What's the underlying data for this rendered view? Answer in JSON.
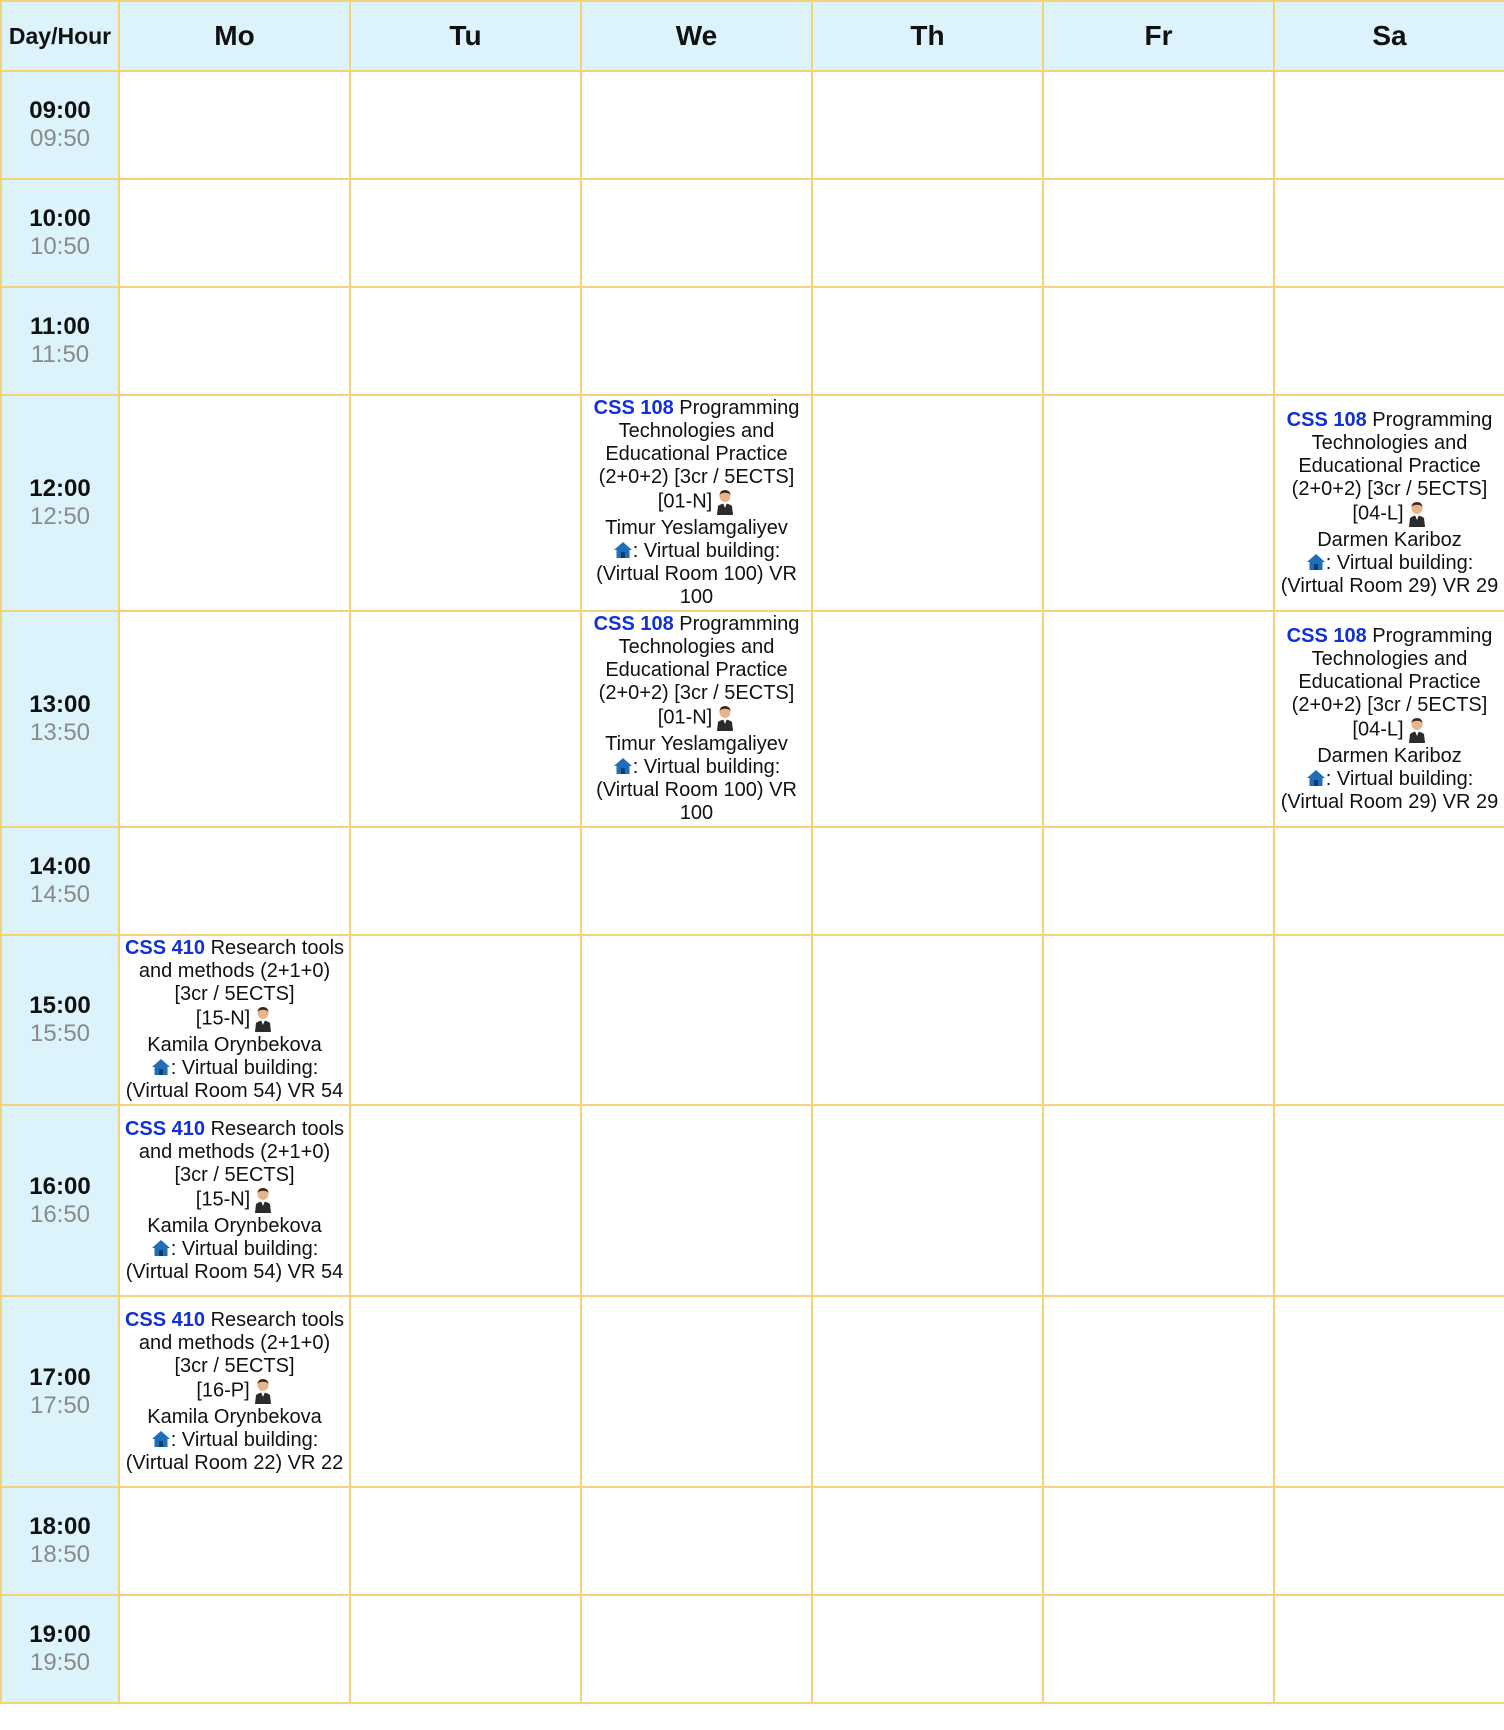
{
  "header": {
    "corner_label": "Day/Hour",
    "days": [
      "Mo",
      "Tu",
      "We",
      "Th",
      "Fr",
      "Sa"
    ]
  },
  "icons": {
    "teacher": "person-icon",
    "location": "home-icon"
  },
  "colors": {
    "header_bg": "#dcf3fb",
    "border": "#f6d27a",
    "course_code": "#1030d8",
    "end_time": "#8a8a8a"
  },
  "rows": [
    {
      "start": "09:00",
      "end": "09:50",
      "cells": [
        null,
        null,
        null,
        null,
        null,
        null
      ]
    },
    {
      "start": "10:00",
      "end": "10:50",
      "cells": [
        null,
        null,
        null,
        null,
        null,
        null
      ]
    },
    {
      "start": "11:00",
      "end": "11:50",
      "cells": [
        null,
        null,
        null,
        null,
        null,
        null
      ]
    },
    {
      "start": "12:00",
      "end": "12:50",
      "cells": [
        null,
        null,
        {
          "code": "CSS 108",
          "title": "Programming Technologies and Educational Practice (2+0+2) [3cr / 5ECTS]",
          "group": "[01-N]",
          "teacher": "Timur Yeslamgaliyev",
          "location": ": Virtual building: (Virtual Room 100) VR 100"
        },
        null,
        null,
        {
          "code": "CSS 108",
          "title": "Programming Technologies and Educational Practice (2+0+2) [3cr / 5ECTS]",
          "group": "[04-L]",
          "teacher": "Darmen Kariboz",
          "location": ": Virtual building: (Virtual Room 29) VR 29"
        }
      ]
    },
    {
      "start": "13:00",
      "end": "13:50",
      "cells": [
        null,
        null,
        {
          "code": "CSS 108",
          "title": "Programming Technologies and Educational Practice (2+0+2) [3cr / 5ECTS]",
          "group": "[01-N]",
          "teacher": "Timur Yeslamgaliyev",
          "location": ": Virtual building: (Virtual Room 100) VR 100"
        },
        null,
        null,
        {
          "code": "CSS 108",
          "title": "Programming Technologies and Educational Practice (2+0+2) [3cr / 5ECTS]",
          "group": "[04-L]",
          "teacher": "Darmen Kariboz",
          "location": ": Virtual building: (Virtual Room 29) VR 29"
        }
      ]
    },
    {
      "start": "14:00",
      "end": "14:50",
      "cells": [
        null,
        null,
        null,
        null,
        null,
        null
      ]
    },
    {
      "start": "15:00",
      "end": "15:50",
      "cells": [
        {
          "code": "CSS 410",
          "title": "Research tools and methods (2+1+0) [3cr / 5ECTS]",
          "group": "[15-N]",
          "teacher": "Kamila Orynbekova",
          "location": ": Virtual building: (Virtual Room 54) VR 54"
        },
        null,
        null,
        null,
        null,
        null
      ]
    },
    {
      "start": "16:00",
      "end": "16:50",
      "cells": [
        {
          "code": "CSS 410",
          "title": "Research tools and methods (2+1+0) [3cr / 5ECTS]",
          "group": "[15-N]",
          "teacher": "Kamila Orynbekova",
          "location": ": Virtual building: (Virtual Room 54) VR 54"
        },
        null,
        null,
        null,
        null,
        null
      ]
    },
    {
      "start": "17:00",
      "end": "17:50",
      "cells": [
        {
          "code": "CSS 410",
          "title": "Research tools and methods (2+1+0) [3cr / 5ECTS]",
          "group": "[16-P]",
          "teacher": "Kamila Orynbekova",
          "location": ": Virtual building: (Virtual Room 22) VR 22"
        },
        null,
        null,
        null,
        null,
        null
      ]
    },
    {
      "start": "18:00",
      "end": "18:50",
      "cells": [
        null,
        null,
        null,
        null,
        null,
        null
      ]
    },
    {
      "start": "19:00",
      "end": "19:50",
      "cells": [
        null,
        null,
        null,
        null,
        null,
        null
      ]
    }
  ]
}
